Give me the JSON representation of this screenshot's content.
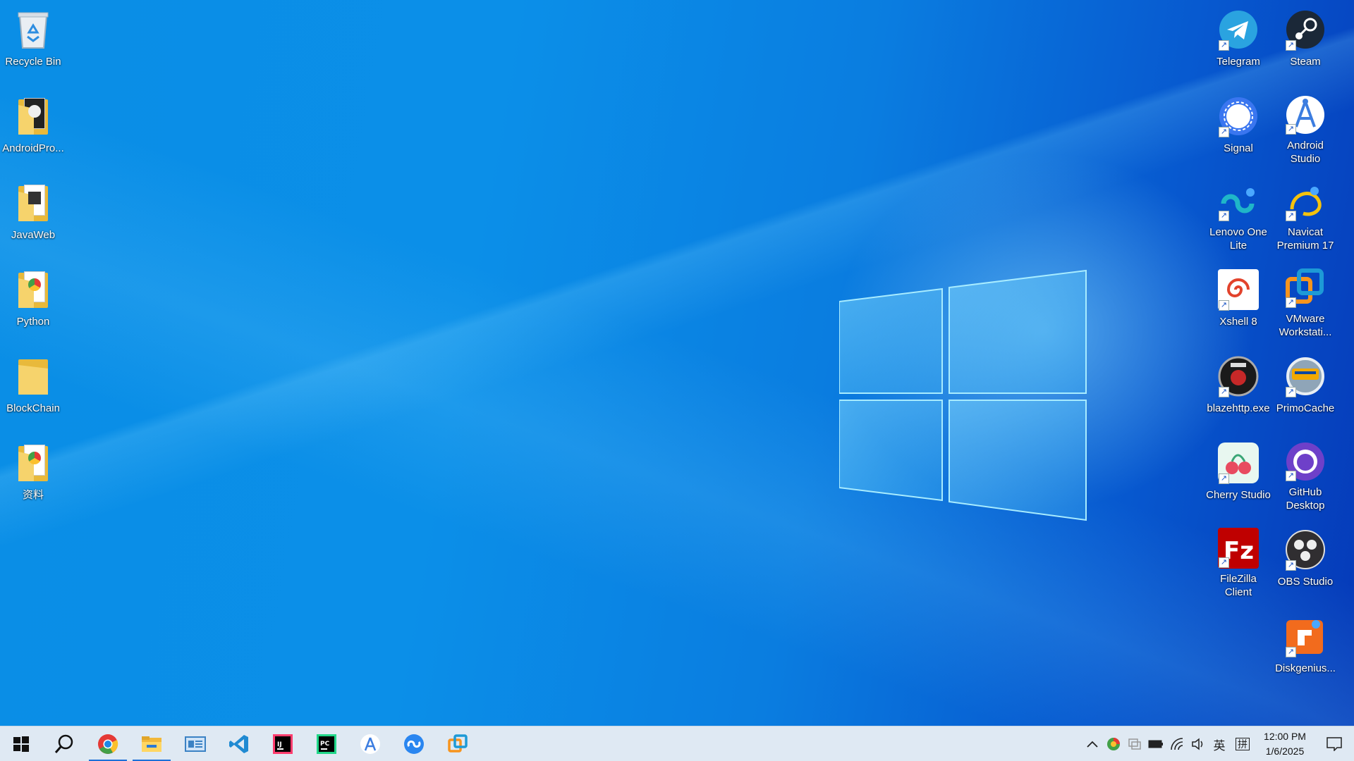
{
  "desktop": {
    "left_icons": [
      {
        "name": "recycle-bin",
        "label": "Recycle Bin"
      },
      {
        "name": "folder-androidpro",
        "label": "AndroidPro..."
      },
      {
        "name": "folder-javaweb",
        "label": "JavaWeb"
      },
      {
        "name": "folder-python",
        "label": "Python"
      },
      {
        "name": "folder-blockchain",
        "label": "BlockChain"
      },
      {
        "name": "folder-ziliao",
        "label": "资料"
      }
    ],
    "right_icons": [
      {
        "name": "telegram",
        "label": "Telegram"
      },
      {
        "name": "steam",
        "label": "Steam"
      },
      {
        "name": "signal",
        "label": "Signal"
      },
      {
        "name": "android-studio",
        "label": "Android Studio"
      },
      {
        "name": "lenovo-one-lite",
        "label": "Lenovo One Lite"
      },
      {
        "name": "navicat",
        "label": "Navicat Premium 17"
      },
      {
        "name": "xshell",
        "label": "Xshell 8"
      },
      {
        "name": "vmware",
        "label": "VMware Workstati..."
      },
      {
        "name": "blazehttp",
        "label": "blazehttp.exe"
      },
      {
        "name": "primocache",
        "label": "PrimoCache"
      },
      {
        "name": "cherry-studio",
        "label": "Cherry Studio"
      },
      {
        "name": "github-desktop",
        "label": "GitHub Desktop"
      },
      {
        "name": "filezilla",
        "label": "FileZilla Client"
      },
      {
        "name": "obs-studio",
        "label": "OBS Studio"
      },
      {
        "name": "diskgenius",
        "label": "Diskgenius..."
      }
    ]
  },
  "taskbar": {
    "apps": [
      "start-icon",
      "search-icon",
      "chrome-icon",
      "file-explorer-icon",
      "control-panel-icon",
      "vscode-icon",
      "intellij-icon",
      "pycharm-icon",
      "android-studio-icon",
      "lenovo-one-lite-icon",
      "vmware-icon"
    ],
    "tray": {
      "ime_label": "英",
      "ime_mode": "拼",
      "time": "12:00 PM",
      "date": "1/6/2025"
    }
  },
  "colors": {
    "desktop_blue": "#0a8ee6",
    "taskbar_bg": "#dfe9f3",
    "active_indicator": "#1c6fd8"
  }
}
